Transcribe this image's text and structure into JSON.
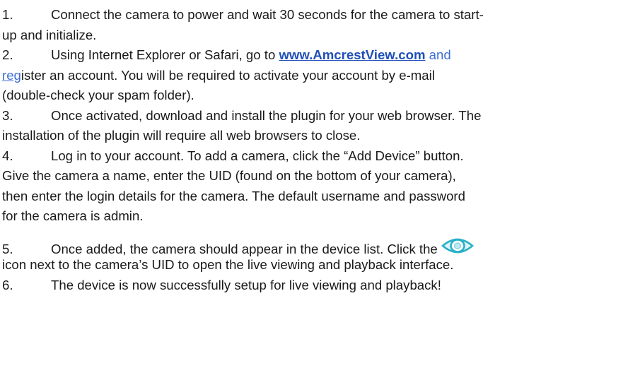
{
  "steps": [
    {
      "num": "1.",
      "lines": [
        "Connect the camera to power and wait 30 seconds for the camera to start-",
        "up and initialize."
      ]
    },
    {
      "num": "2.",
      "text_before_link": "Using Internet Explorer or Safari, go to ",
      "link_text": "www.AmcrestView.com",
      "link_tail": " and",
      "line2_link_part": "reg",
      "line2_rest": "ister an account. You will be required to activate your account by e-mail",
      "line3": "(double-check your spam folder)."
    },
    {
      "num": "3.",
      "lines": [
        "Once activated, download and install the plugin for your web browser. The",
        "installation of the plugin will require all web browsers to close."
      ]
    },
    {
      "num": "4.",
      "lines": [
        "Log in to your account. To add a camera, click the “Add Device” button.",
        "Give the camera a name, enter the UID (found on the bottom of your camera),",
        "then enter the login details for the camera. The default username and password",
        "for the camera is admin."
      ]
    },
    {
      "num": "5.",
      "text_before_icon": "Once added, the camera should appear in the device list. Click the",
      "icon": "eye-icon",
      "line2": "icon next to the camera’s UID to open the live viewing and playback interface."
    },
    {
      "num": "6.",
      "lines": [
        "The device is now successfully setup for live viewing and playback!"
      ]
    }
  ],
  "colors": {
    "link": "#1f4fb8",
    "icon": "#2ab0c8"
  }
}
